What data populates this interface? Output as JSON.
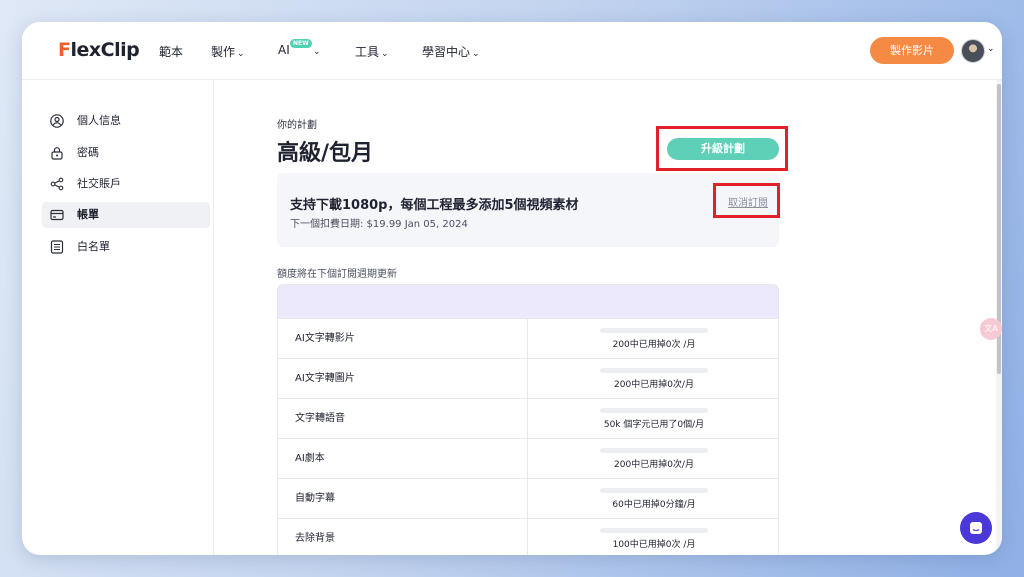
{
  "header": {
    "logo_initial": "F",
    "logo_rest": "lexClip",
    "nav": [
      "範本",
      "製作",
      "AI",
      "工具",
      "學習中心"
    ],
    "new_badge": "NEW",
    "make_video_label": "製作影片"
  },
  "sidebar": {
    "items": [
      {
        "label": "個人信息",
        "icon": "user-icon"
      },
      {
        "label": "密碼",
        "icon": "lock-icon"
      },
      {
        "label": "社交賬戶",
        "icon": "share-icon"
      },
      {
        "label": "帳單",
        "icon": "card-icon",
        "active": true
      },
      {
        "label": "白名單",
        "icon": "list-icon"
      }
    ]
  },
  "plan": {
    "label": "你的計劃",
    "title": "高級/包月",
    "upgrade_label": "升級計劃",
    "feature": "支持下載1080p，每個工程最多添加5個視頻素材",
    "next_billing": "下一個扣費日期: $19.99 Jan 05, 2024",
    "cancel_label": "取消訂閱",
    "quota_note": "額度將在下個訂閱週期更新"
  },
  "usage": [
    {
      "name": "AI文字轉影片",
      "value": "200中已用掉0次 /月"
    },
    {
      "name": "AI文字轉圖片",
      "value": "200中已用掉0次/月"
    },
    {
      "name": "文字轉語音",
      "value": "50k 個字元已用了0個/月"
    },
    {
      "name": "AI劇本",
      "value": "200中已用掉0次/月"
    },
    {
      "name": "自動字幕",
      "value": "60中已用掉0分鐘/月"
    },
    {
      "name": "去除背景",
      "value": "100中已用掉0次 /月"
    }
  ],
  "colors": {
    "accent_orange": "#f58a45",
    "accent_teal": "#5fd0b8",
    "highlight_red": "#e3202a",
    "table_header": "#ebe9fb"
  }
}
